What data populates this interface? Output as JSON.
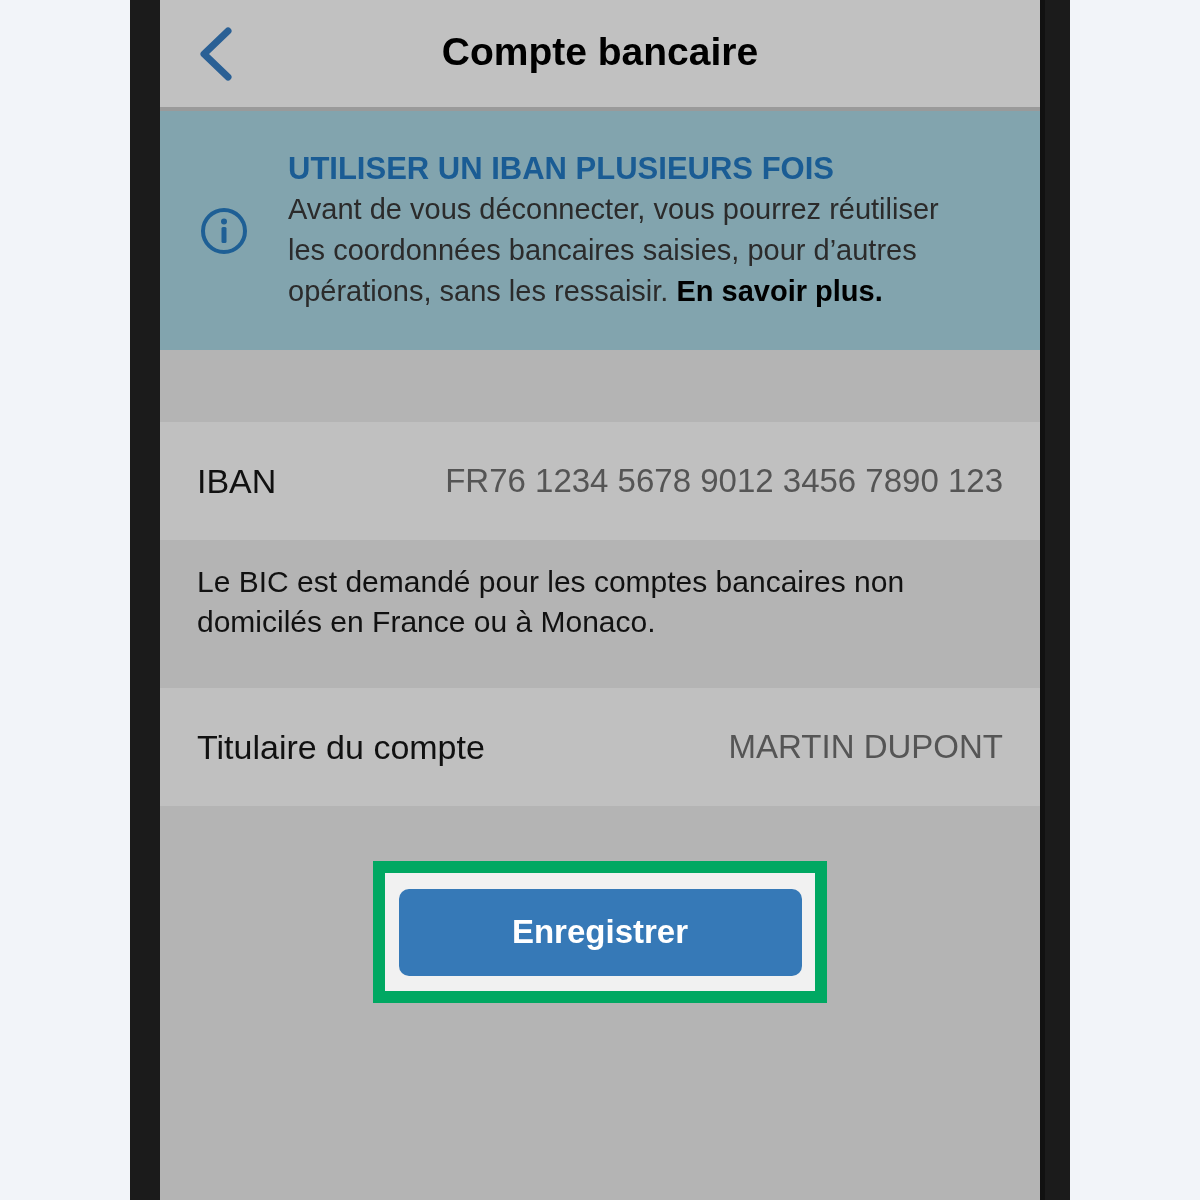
{
  "header": {
    "title": "Compte bancaire"
  },
  "banner": {
    "title": "UTILISER UN IBAN PLUSIEURS FOIS",
    "text": "Avant de vous déconnecter, vous pourrez réutiliser les coordonnées bancaires saisies, pour d’autres opérations, sans les ressaisir.",
    "link": "En savoir plus."
  },
  "rows": [
    {
      "kind": "field",
      "label": "IBAN",
      "value": "FR76 1234 5678 9012 3456 7890 123"
    },
    {
      "kind": "note",
      "text": "Le BIC est demandé pour les comptes bancaires non domicilés en France ou à Monaco."
    },
    {
      "kind": "field",
      "label": "Titulaire du compte",
      "value": "MARTIN DUPONT"
    }
  ],
  "save_button": {
    "label": "Enregistrer",
    "highlighted": true
  }
}
